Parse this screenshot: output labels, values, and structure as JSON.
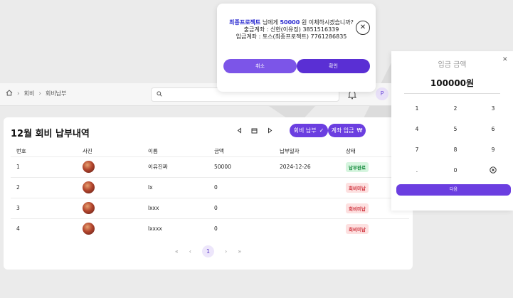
{
  "header": {
    "breadcrumb": [
      "회비",
      "회비납부"
    ],
    "search_placeholder": "",
    "profile_initial": "P"
  },
  "page": {
    "title": "12월 회비 납부내역",
    "pay_button": "회비 납부",
    "deposit_button": "계좌 입금",
    "columns": [
      "번호",
      "사진",
      "이름",
      "금액",
      "납부일자",
      "상태"
    ],
    "rows": [
      {
        "no": "1",
        "name": "이유진짜",
        "amount": "50000",
        "date": "2024-12-26",
        "status": "납부완료"
      },
      {
        "no": "2",
        "name": "lx",
        "amount": "0",
        "date": "",
        "status": "회비미납"
      },
      {
        "no": "3",
        "name": "lxxx",
        "amount": "0",
        "date": "",
        "status": "회비미납"
      },
      {
        "no": "4",
        "name": "lxxxx",
        "amount": "0",
        "date": "",
        "status": "회비미납"
      }
    ],
    "pagination": {
      "first": "«",
      "prev": "‹",
      "current": "1",
      "next": "›",
      "last": "»"
    }
  },
  "confirm_dialog": {
    "recipient": "최종프로젝트",
    "text_1": " 님에게 ",
    "amount": "50000",
    "text_2": " 원 이체하시겠습니까?",
    "from_account": "출금계좌 : 신한(이유징) 3851516339",
    "to_account": "입금계좌 : 토스(최종프로젝트) 7761286835",
    "cancel_label": "취소",
    "confirm_label": "확인"
  },
  "keypad": {
    "title": "입금 금액",
    "amount": "100000원",
    "keys": [
      "1",
      "2",
      "3",
      "4",
      "5",
      "6",
      "7",
      "8",
      "9",
      ".",
      "0"
    ],
    "next_label": "다음"
  },
  "colors": {
    "accent": "#6b3ee0",
    "paid": "#148a3c",
    "unpaid": "#d0343f"
  }
}
